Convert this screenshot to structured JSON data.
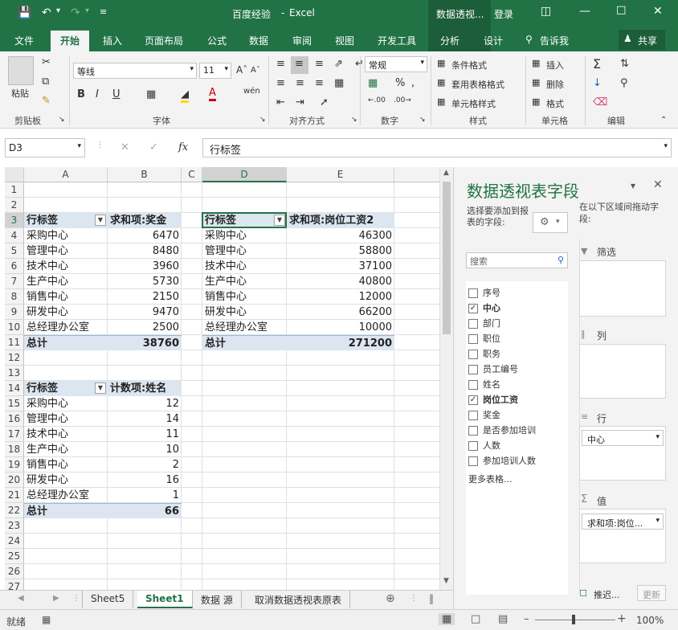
{
  "title_bar": {
    "doc_title": "百度经验",
    "app_name": "Excel",
    "context_title": "数据透视...",
    "login": "登录"
  },
  "tabs": [
    "文件",
    "开始",
    "插入",
    "页面布局",
    "公式",
    "数据",
    "审阅",
    "视图",
    "开发工具",
    "分析",
    "设计"
  ],
  "tell_me": "告诉我",
  "share": "共享",
  "ribbon": {
    "paste": "粘贴",
    "font_name": "等线",
    "font_size": "11",
    "number_format": "常规",
    "cond_format": "条件格式",
    "table_format": "套用表格格式",
    "cell_style": "单元格样式",
    "insert": "插入",
    "delete": "删除",
    "format": "格式",
    "groups": {
      "clipboard": "剪贴板",
      "font": "字体",
      "alignment": "对齐方式",
      "number": "数字",
      "styles": "样式",
      "cells": "单元格",
      "editing": "编辑"
    }
  },
  "formula_bar": {
    "name_box": "D3",
    "formula": "行标签"
  },
  "columns": [
    "A",
    "B",
    "C",
    "D",
    "E"
  ],
  "rows": [
    "1",
    "2",
    "3",
    "4",
    "5",
    "6",
    "7",
    "8",
    "9",
    "10",
    "11",
    "12",
    "13",
    "14",
    "15",
    "16",
    "17",
    "18",
    "19",
    "20",
    "21",
    "22",
    "23",
    "24",
    "25",
    "26",
    "27"
  ],
  "pivot1": {
    "header": [
      "行标签",
      "求和项:奖金"
    ],
    "rows": [
      [
        "采购中心",
        "6470"
      ],
      [
        "管理中心",
        "8480"
      ],
      [
        "技术中心",
        "3960"
      ],
      [
        "生产中心",
        "5730"
      ],
      [
        "销售中心",
        "2150"
      ],
      [
        "研发中心",
        "9470"
      ],
      [
        "总经理办公室",
        "2500"
      ]
    ],
    "total": [
      "总计",
      "38760"
    ]
  },
  "pivot2": {
    "header": [
      "行标签",
      "求和项:岗位工资2"
    ],
    "rows": [
      [
        "采购中心",
        "46300"
      ],
      [
        "管理中心",
        "58800"
      ],
      [
        "技术中心",
        "37100"
      ],
      [
        "生产中心",
        "40800"
      ],
      [
        "销售中心",
        "12000"
      ],
      [
        "研发中心",
        "66200"
      ],
      [
        "总经理办公室",
        "10000"
      ]
    ],
    "total": [
      "总计",
      "271200"
    ]
  },
  "pivot3": {
    "header": [
      "行标签",
      "计数项:姓名"
    ],
    "rows": [
      [
        "采购中心",
        "12"
      ],
      [
        "管理中心",
        "14"
      ],
      [
        "技术中心",
        "11"
      ],
      [
        "生产中心",
        "10"
      ],
      [
        "销售中心",
        "2"
      ],
      [
        "研发中心",
        "16"
      ],
      [
        "总经理办公室",
        "1"
      ]
    ],
    "total": [
      "总计",
      "66"
    ]
  },
  "sheet_tabs": [
    "Sheet5",
    "Sheet1",
    "数据 源",
    "取消数据透视表原表"
  ],
  "active_sheet": "Sheet1",
  "pane": {
    "title": "数据透视表字段",
    "instruction": "选择要添加到报表的字段:",
    "drag_hint": "在以下区域间拖动字段:",
    "search_placeholder": "搜索",
    "fields": [
      {
        "name": "序号",
        "checked": false
      },
      {
        "name": "中心",
        "checked": true
      },
      {
        "name": "部门",
        "checked": false
      },
      {
        "name": "职位",
        "checked": false
      },
      {
        "name": "职务",
        "checked": false
      },
      {
        "name": "员工编号",
        "checked": false
      },
      {
        "name": "姓名",
        "checked": false
      },
      {
        "name": "岗位工资",
        "checked": true
      },
      {
        "name": "奖金",
        "checked": false
      },
      {
        "name": "是否参加培训",
        "checked": false
      },
      {
        "name": "人数",
        "checked": false
      },
      {
        "name": "参加培训人数",
        "checked": false
      }
    ],
    "more_tables": "更多表格...",
    "areas": {
      "filter": "筛选",
      "columns": "列",
      "rows": "行",
      "values": "值"
    },
    "row_item": "中心",
    "value_item": "求和项:岗位...",
    "defer": "推迟...",
    "update": "更新"
  },
  "status": {
    "ready": "就绪",
    "zoom": "100%"
  },
  "colors": {
    "accent": "#217346",
    "pivot_header": "#dce6f1"
  }
}
